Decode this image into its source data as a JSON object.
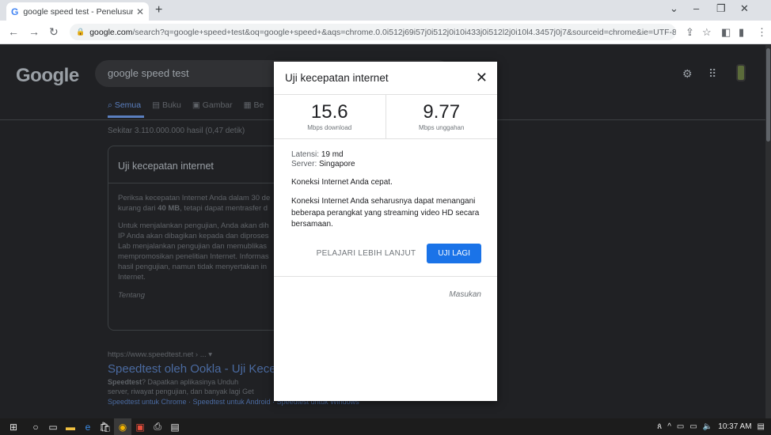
{
  "browser": {
    "tab_title": "google speed test - Penelusuran",
    "tab_favicon": "G",
    "url_host": "google.com",
    "url_rest": "/search?q=google+speed+test&oq=google+speed+&aqs=chrome.0.0i512j69i57j0i512j0i10i433j0i512l2j0i10l4.3457j0j7&sourceid=chrome&ie=UTF-8"
  },
  "google": {
    "logo": "Google",
    "query": "google speed test",
    "tabs": [
      "Semua",
      "Buku",
      "Gambar",
      "Be"
    ],
    "result_count": "Sekitar 3.110.000.000 hasil (0,47 detik)",
    "card": {
      "title": "Uji kecepatan internet",
      "para1_a": "Periksa kecepatan Internet Anda dalam 30 de",
      "para1_b_pre": "kurang dari ",
      "para1_b_bold": "40 MB",
      "para1_b_post": ", tetapi dapat mentrasfer d",
      "para2": [
        "Untuk menjalankan pengujian, Anda akan dih",
        "IP Anda akan dibagikan kepada dan diproses",
        "Lab menjalankan pengujian dan memublikas",
        "mempromosikan penelitian Internet. Informas",
        "hasil pengujian, namun tidak menyertakan in",
        "Internet."
      ],
      "footer": "Tentang"
    },
    "result": {
      "cite": "https://www.speedtest.net › ... ▾",
      "title": "Speedtest oleh Ookla - Uji Kecep",
      "snippet_bold": "Speedtest",
      "snippet_a": "? Dapatkan aplikasinya Unduh",
      "snippet_b": "server, riwayat pengujian, dan banyak lagi Get",
      "sitelinks": "Speedtest untuk Chrome · Speedtest untuk Android · Speedtest untuk Windows"
    }
  },
  "modal": {
    "title": "Uji kecepatan internet",
    "download_value": "15.6",
    "download_unit": "Mbps download",
    "upload_value": "9.77",
    "upload_unit": "Mbps unggahan",
    "latency_label": "Latensi:",
    "latency_value": "19 md",
    "server_label": "Server:",
    "server_value": "Singapore",
    "status": "Koneksi Internet Anda cepat.",
    "detail": "Koneksi Internet Anda seharusnya dapat menangani beberapa perangkat yang streaming video HD secara bersamaan.",
    "learn_more": "PELAJARI LEBIH LANJUT",
    "retry": "UJI LAGI",
    "feedback": "Masukan"
  },
  "taskbar": {
    "time": "10:37 AM"
  }
}
